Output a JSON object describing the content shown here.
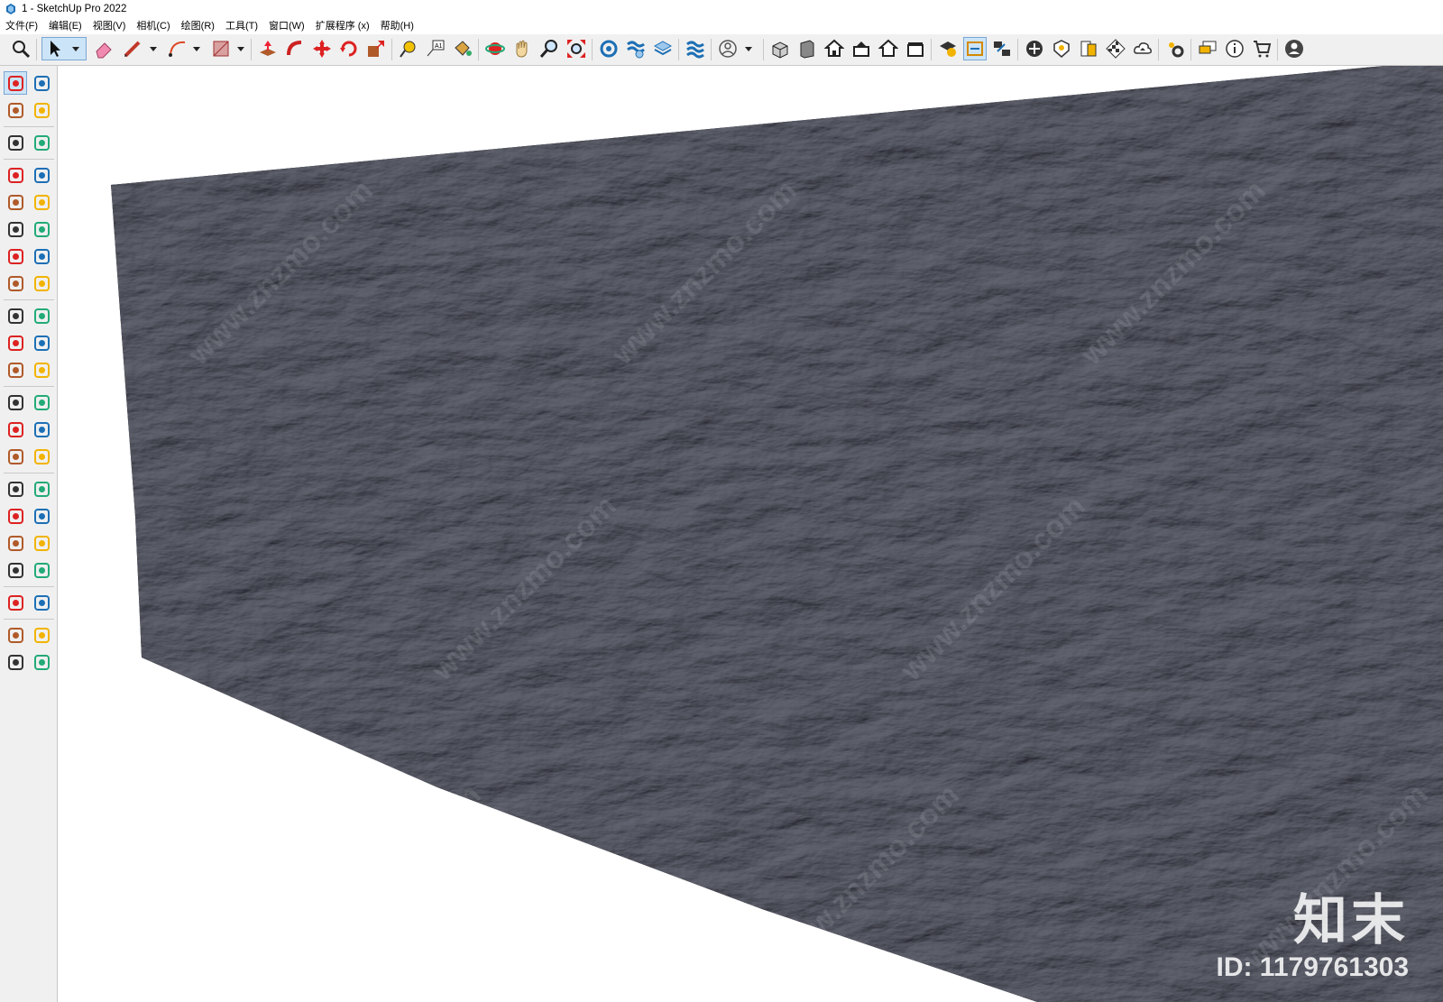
{
  "window": {
    "title": "1 - SketchUp Pro 2022"
  },
  "menu": {
    "items": [
      "文件(F)",
      "编辑(E)",
      "视图(V)",
      "相机(C)",
      "绘图(R)",
      "工具(T)",
      "窗口(W)",
      "扩展程序 (x)",
      "帮助(H)"
    ]
  },
  "toolbar": {
    "icons": [
      "zoom-icon",
      "select-icon",
      "eraser-icon",
      "pencil-icon",
      "arc-icon",
      "rectangle-icon",
      "push-pull-icon",
      "follow-me-icon",
      "move-icon",
      "rotate-icon",
      "scale-icon",
      "tape-measure-icon",
      "text-icon",
      "paint-bucket-icon",
      "orbit-icon",
      "pan-icon",
      "zoom-tool-icon",
      "zoom-extents-icon",
      "tag-icon",
      "section-icon",
      "layers-icon",
      "solid-icon",
      "user-icon",
      "iso-view-icon",
      "front-view-icon",
      "home-view-icon",
      "top-view-icon",
      "back-view-icon",
      "box-view-icon",
      "check-icon",
      "share-icon",
      "model-info-icon",
      "add-icon",
      "shield-icon",
      "style-icon",
      "checker-icon",
      "cloud-icon",
      "settings-icon",
      "chat-icon",
      "info-icon",
      "cart-icon",
      "account-icon"
    ]
  },
  "left_toolbar": {
    "icons": [
      "select-icon",
      "orbit-icon",
      "paint-icon",
      "eraser-icon",
      "component-icon",
      "tape-icon",
      "pencil-icon",
      "freehand-icon",
      "rectangle-icon",
      "rotated-rect-icon",
      "circle-icon",
      "polygon-icon",
      "arc-icon",
      "arc2-icon",
      "pie-icon",
      "arc3-icon",
      "move-icon",
      "push-pull-icon",
      "rotate-icon",
      "follow-me-icon",
      "scale-icon",
      "offset-icon",
      "tape-measure-icon",
      "dimension-icon",
      "protractor-icon",
      "text-icon",
      "axes-icon",
      "3d-text-icon",
      "orbit2-icon",
      "pan-icon",
      "zoom-icon",
      "zoom-window-icon",
      "zoom-extents-icon",
      "previous-view-icon",
      "position-camera-icon",
      "look-around-icon",
      "walk-icon",
      "section-plane-icon",
      "tag-icon",
      "section2-icon",
      "layers-icon",
      "solid2-icon"
    ]
  },
  "viewport": {
    "watermark": "www.znzmo.com",
    "watermark_site": "知末网",
    "logo": "知末",
    "id_label": "ID: 1179761303"
  }
}
